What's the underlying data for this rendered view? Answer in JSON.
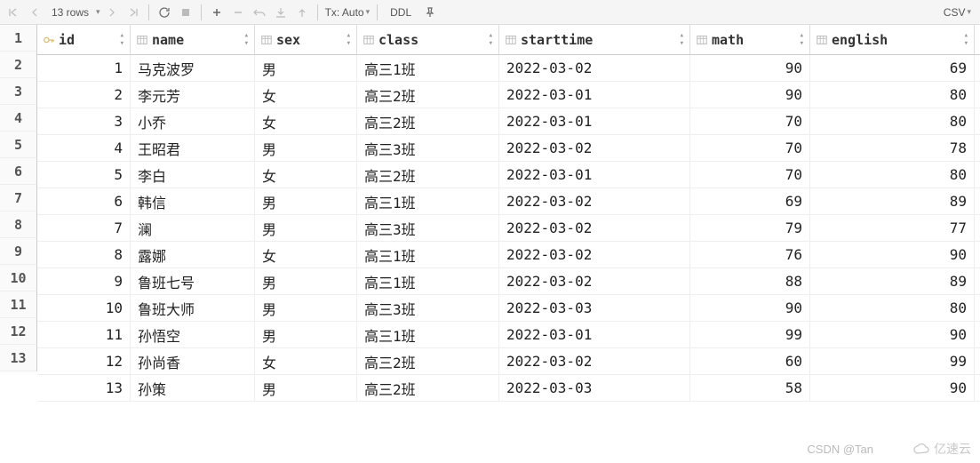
{
  "toolbar": {
    "row_info": "13 rows",
    "tx_label": "Tx: Auto",
    "ddl": "DDL",
    "export": "CSV"
  },
  "columns": [
    {
      "key": "id",
      "label": "id",
      "type": "key",
      "cls": "c-id",
      "num": true
    },
    {
      "key": "name",
      "label": "name",
      "type": "col",
      "cls": "c-name",
      "num": false
    },
    {
      "key": "sex",
      "label": "sex",
      "type": "col",
      "cls": "c-sex",
      "num": false
    },
    {
      "key": "class",
      "label": "class",
      "type": "col",
      "cls": "c-class",
      "num": false
    },
    {
      "key": "starttime",
      "label": "starttime",
      "type": "col",
      "cls": "c-start",
      "num": false
    },
    {
      "key": "math",
      "label": "math",
      "type": "col",
      "cls": "c-math",
      "num": true
    },
    {
      "key": "english",
      "label": "english",
      "type": "col",
      "cls": "c-eng",
      "num": true
    }
  ],
  "rows": [
    {
      "id": 1,
      "name": "马克波罗",
      "sex": "男",
      "class": "高三1班",
      "starttime": "2022-03-02",
      "math": 90,
      "english": 69
    },
    {
      "id": 2,
      "name": "李元芳",
      "sex": "女",
      "class": "高三2班",
      "starttime": "2022-03-01",
      "math": 90,
      "english": 80
    },
    {
      "id": 3,
      "name": "小乔",
      "sex": "女",
      "class": "高三2班",
      "starttime": "2022-03-01",
      "math": 70,
      "english": 80
    },
    {
      "id": 4,
      "name": "王昭君",
      "sex": "男",
      "class": "高三3班",
      "starttime": "2022-03-02",
      "math": 70,
      "english": 78
    },
    {
      "id": 5,
      "name": "李白",
      "sex": "女",
      "class": "高三2班",
      "starttime": "2022-03-01",
      "math": 70,
      "english": 80
    },
    {
      "id": 6,
      "name": "韩信",
      "sex": "男",
      "class": "高三1班",
      "starttime": "2022-03-02",
      "math": 69,
      "english": 89
    },
    {
      "id": 7,
      "name": "澜",
      "sex": "男",
      "class": "高三3班",
      "starttime": "2022-03-02",
      "math": 79,
      "english": 77
    },
    {
      "id": 8,
      "name": "露娜",
      "sex": "女",
      "class": "高三1班",
      "starttime": "2022-03-02",
      "math": 76,
      "english": 90
    },
    {
      "id": 9,
      "name": "鲁班七号",
      "sex": "男",
      "class": "高三1班",
      "starttime": "2022-03-02",
      "math": 88,
      "english": 89
    },
    {
      "id": 10,
      "name": "鲁班大师",
      "sex": "男",
      "class": "高三3班",
      "starttime": "2022-03-03",
      "math": 90,
      "english": 80
    },
    {
      "id": 11,
      "name": "孙悟空",
      "sex": "男",
      "class": "高三1班",
      "starttime": "2022-03-01",
      "math": 99,
      "english": 90
    },
    {
      "id": 12,
      "name": "孙尚香",
      "sex": "女",
      "class": "高三2班",
      "starttime": "2022-03-02",
      "math": 60,
      "english": 99
    },
    {
      "id": 13,
      "name": "孙策",
      "sex": "男",
      "class": "高三2班",
      "starttime": "2022-03-03",
      "math": 58,
      "english": 90
    }
  ],
  "watermark1": "CSDN @Tan",
  "watermark2": "亿速云"
}
